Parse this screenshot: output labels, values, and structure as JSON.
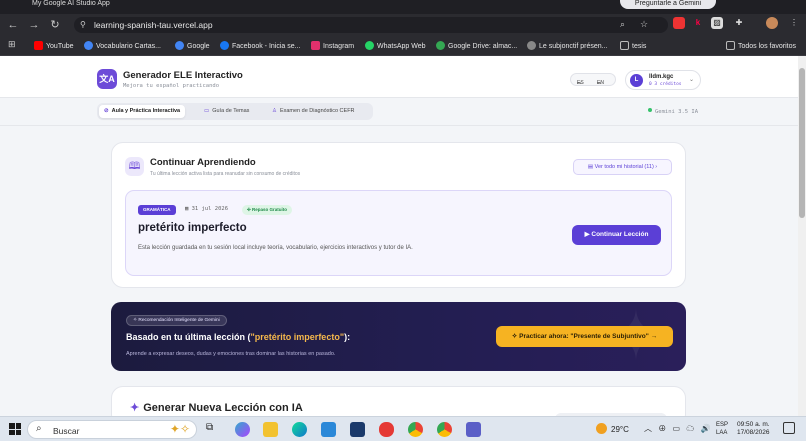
{
  "browser": {
    "tab_title": "My Google AI Studio App",
    "gemini_pill": "Preguntarle a Gemini",
    "url": "learning-spanish-tau.vercel.app",
    "bookmarks": [
      {
        "label": "YouTube",
        "color": "#ff0000"
      },
      {
        "label": "Vocabulario Cartas...",
        "color": "#4285f4"
      },
      {
        "label": "Google",
        "color": "#4285f4"
      },
      {
        "label": "Facebook - Inicia se...",
        "color": "#1877f2"
      },
      {
        "label": "Instagram",
        "color": "#e1306c"
      },
      {
        "label": "WhatsApp Web",
        "color": "#25d366"
      },
      {
        "label": "Google Drive: almac...",
        "color": "#34a853"
      },
      {
        "label": "Le subjonctif présen...",
        "color": "#888888"
      },
      {
        "label": "tesis",
        "color": "#888888"
      }
    ],
    "all_bookmarks": "Todos los favoritos"
  },
  "app": {
    "title": "Generador ELE Interactivo",
    "subtitle": "Mejora tu español practicando",
    "lang_from": "ES",
    "lang_to": "EN",
    "user": {
      "initial": "L",
      "name": "lldm.kgc",
      "credits": "0 3 créditos"
    }
  },
  "subnav": {
    "tabs": [
      {
        "label": "Aula y Práctica Interactiva",
        "active": true
      },
      {
        "label": "Guía de Temas",
        "active": false
      },
      {
        "label": "Examen de Diagnóstico CEFR",
        "active": false
      }
    ],
    "gemini_status": "Gemini 3.5 IA"
  },
  "continue": {
    "title": "Continuar Aprendiendo",
    "subtitle": "Tu última lección activa lista para reanudar sin consumo de créditos",
    "history_button": "Ver todo mi historial (11)",
    "lesson": {
      "badge": "GRAMÁTICA",
      "date": "31 jul 2026",
      "free_badge": "Repaso Gratuito",
      "title": "pretérito imperfecto",
      "description": "Esta lección guardada en tu sesión local incluye teoría, vocabulario, ejercicios interactivos y tutor de IA.",
      "continue_button": "Continuar Lección"
    }
  },
  "recommendation": {
    "badge": "Recomendación Inteligente de Gemini",
    "title_prefix": "Basado en tu última lección (",
    "title_highlight": "\"pretérito imperfecto\"",
    "title_suffix": "):",
    "subtitle": "Aprende a expresar deseos, dudas y emociones tras dominar las historias en pasado.",
    "button": "Practicar ahora: \"Presente de Subjuntivo\""
  },
  "generate": {
    "title": "Generar Nueva Lección con IA"
  },
  "taskbar": {
    "search_placeholder": "Buscar",
    "temperature": "29°C",
    "lang_line1": "ESP",
    "lang_line2": "LAA",
    "time": "09:50 a. m.",
    "date": "17/08/2026"
  }
}
